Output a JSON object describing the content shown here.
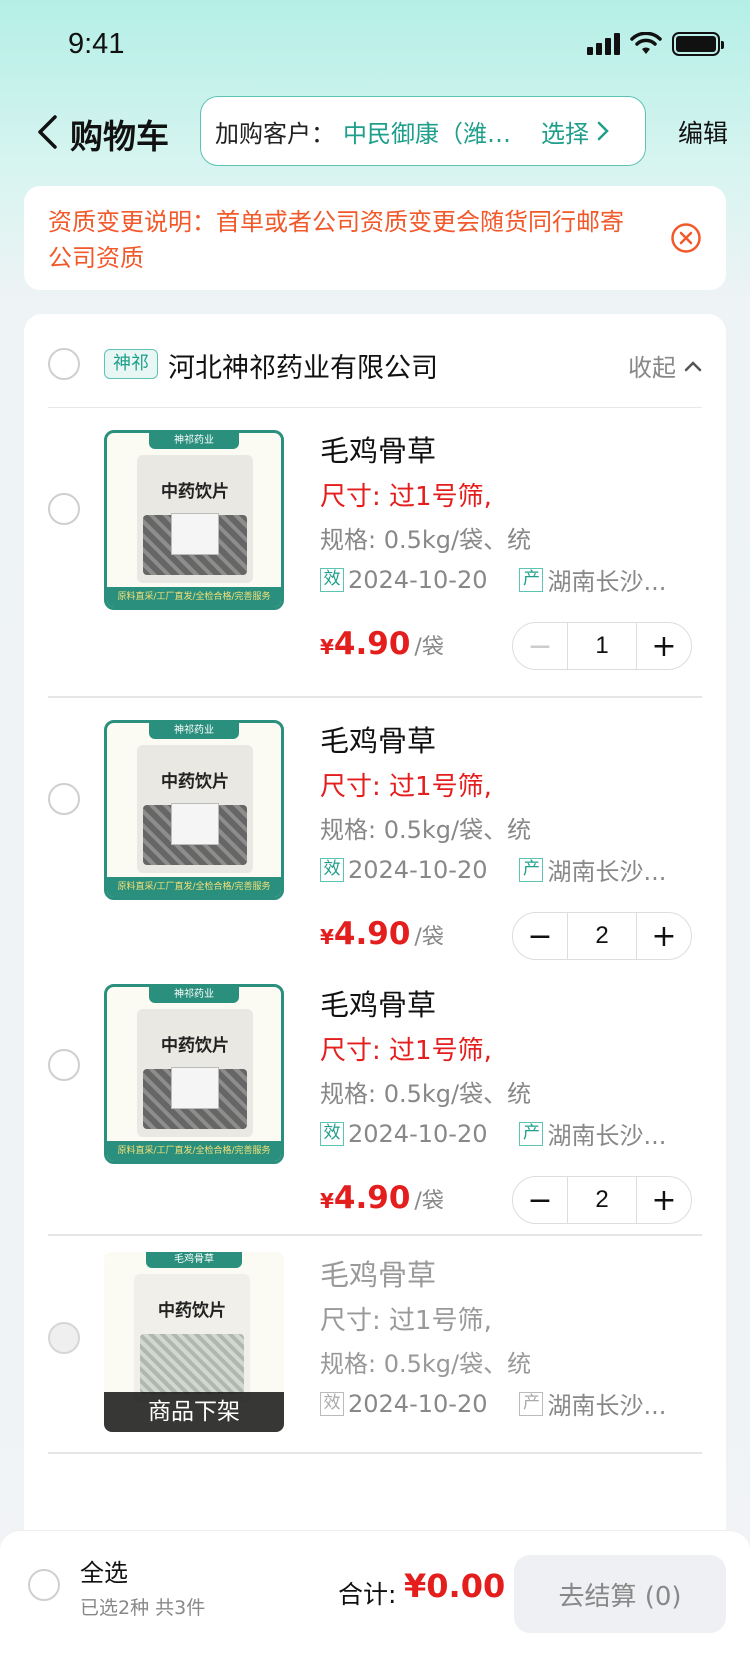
{
  "status_bar": {
    "time": "9:41"
  },
  "nav": {
    "title": "购物车",
    "customer_label": "加购客户：",
    "customer_name": "中民御康（潍…",
    "select_label": "选择",
    "edit_label": "编辑"
  },
  "notice": {
    "text": "资质变更说明：首单或者公司资质变更会随货同行邮寄公司资质"
  },
  "shop": {
    "tag": "神祁",
    "name": "河北神祁药业有限公司",
    "collapse_label": "收起"
  },
  "items": [
    {
      "name": "毛鸡骨草",
      "size": "尺寸: 过1号筛,",
      "spec": "规格: 0.5kg/袋、统",
      "expiry_tag": "效",
      "expiry": "2024-10-20",
      "origin_tag": "产",
      "origin": "湖南长沙...",
      "price_symbol": "¥",
      "price": "4.90",
      "unit": "/袋",
      "qty": "1"
    },
    {
      "name": "毛鸡骨草",
      "size": "尺寸: 过1号筛,",
      "spec": "规格: 0.5kg/袋、统",
      "expiry_tag": "效",
      "expiry": "2024-10-20",
      "origin_tag": "产",
      "origin": "湖南长沙...",
      "price_symbol": "¥",
      "price": "4.90",
      "unit": "/袋",
      "qty": "2"
    },
    {
      "name": "毛鸡骨草",
      "size": "尺寸: 过1号筛,",
      "spec": "规格: 0.5kg/袋、统",
      "expiry_tag": "效",
      "expiry": "2024-10-20",
      "origin_tag": "产",
      "origin": "湖南长沙...",
      "price_symbol": "¥",
      "price": "4.90",
      "unit": "/袋",
      "qty": "2"
    },
    {
      "name": "毛鸡骨草",
      "size": "尺寸: 过1号筛,",
      "spec": "规格: 0.5kg/袋、统",
      "expiry_tag": "效",
      "expiry": "2024-10-20",
      "origin_tag": "产",
      "origin": "湖南长沙...",
      "offline_label": "商品下架"
    }
  ],
  "thumb": {
    "brand": "神祁药业",
    "bag_title": "中药饮片",
    "footer": "原料直采/工厂直发/全检合格/完善服务",
    "alt_strip": "毛鸡骨草"
  },
  "bottom": {
    "select_all": "全选",
    "selected_info": "已选2种  共3件",
    "total_label": "合计:",
    "total_value": "¥0.00",
    "checkout_label": "去结算 (0)"
  },
  "colors": {
    "accent": "#1f9f8b",
    "price": "#e41d1d",
    "notice": "#f2592a"
  },
  "icons": [
    "back-chevron-icon",
    "chevron-right-icon",
    "close-circle-icon",
    "chevron-up-icon",
    "minus-icon",
    "plus-icon",
    "signal-icon",
    "wifi-icon",
    "battery-icon"
  ]
}
